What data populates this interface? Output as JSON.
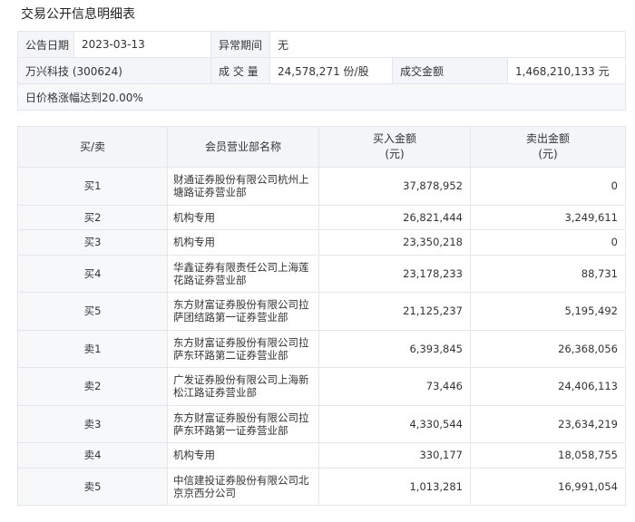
{
  "page": {
    "title": "交易公开信息明细表"
  },
  "info": {
    "date_label": "公告日期",
    "date_value": "2023-03-13",
    "period_label": "异常期间",
    "period_value": "无",
    "stock": "万兴科技 (300624)",
    "volume_label": "成 交 量",
    "volume_value": "24,578,271 份/股",
    "amount_label": "成交金额",
    "amount_value": "1,468,210,133 元",
    "reason": "日价格涨幅达到20.00%"
  },
  "detail": {
    "headers": {
      "type": "买/卖",
      "name": "会员营业部名称",
      "buy_line1": "买入金额",
      "buy_line2": "(元)",
      "sell_line1": "卖出金额",
      "sell_line2": "(元)"
    },
    "rows": [
      {
        "type": "买1",
        "name": "财通证券股份有限公司杭州上塘路证券营业部",
        "buy": "37,878,952",
        "sell": "0"
      },
      {
        "type": "买2",
        "name": "机构专用",
        "buy": "26,821,444",
        "sell": "3,249,611"
      },
      {
        "type": "买3",
        "name": "机构专用",
        "buy": "23,350,218",
        "sell": "0"
      },
      {
        "type": "买4",
        "name": "华鑫证券有限责任公司上海莲花路证券营业部",
        "buy": "23,178,233",
        "sell": "88,731"
      },
      {
        "type": "买5",
        "name": "东方财富证券股份有限公司拉萨团结路第一证券营业部",
        "buy": "21,125,237",
        "sell": "5,195,492"
      },
      {
        "type": "卖1",
        "name": "东方财富证券股份有限公司拉萨东环路第二证券营业部",
        "buy": "6,393,845",
        "sell": "26,368,056"
      },
      {
        "type": "卖2",
        "name": "广发证券股份有限公司上海新松江路证券营业部",
        "buy": "73,446",
        "sell": "24,406,113"
      },
      {
        "type": "卖3",
        "name": "东方财富证券股份有限公司拉萨东环路第一证券营业部",
        "buy": "4,330,544",
        "sell": "23,634,219"
      },
      {
        "type": "卖4",
        "name": "机构专用",
        "buy": "330,177",
        "sell": "18,058,755"
      },
      {
        "type": "卖5",
        "name": "中信建投证券股份有限公司北京京西分公司",
        "buy": "1,013,281",
        "sell": "16,991,054"
      }
    ]
  }
}
